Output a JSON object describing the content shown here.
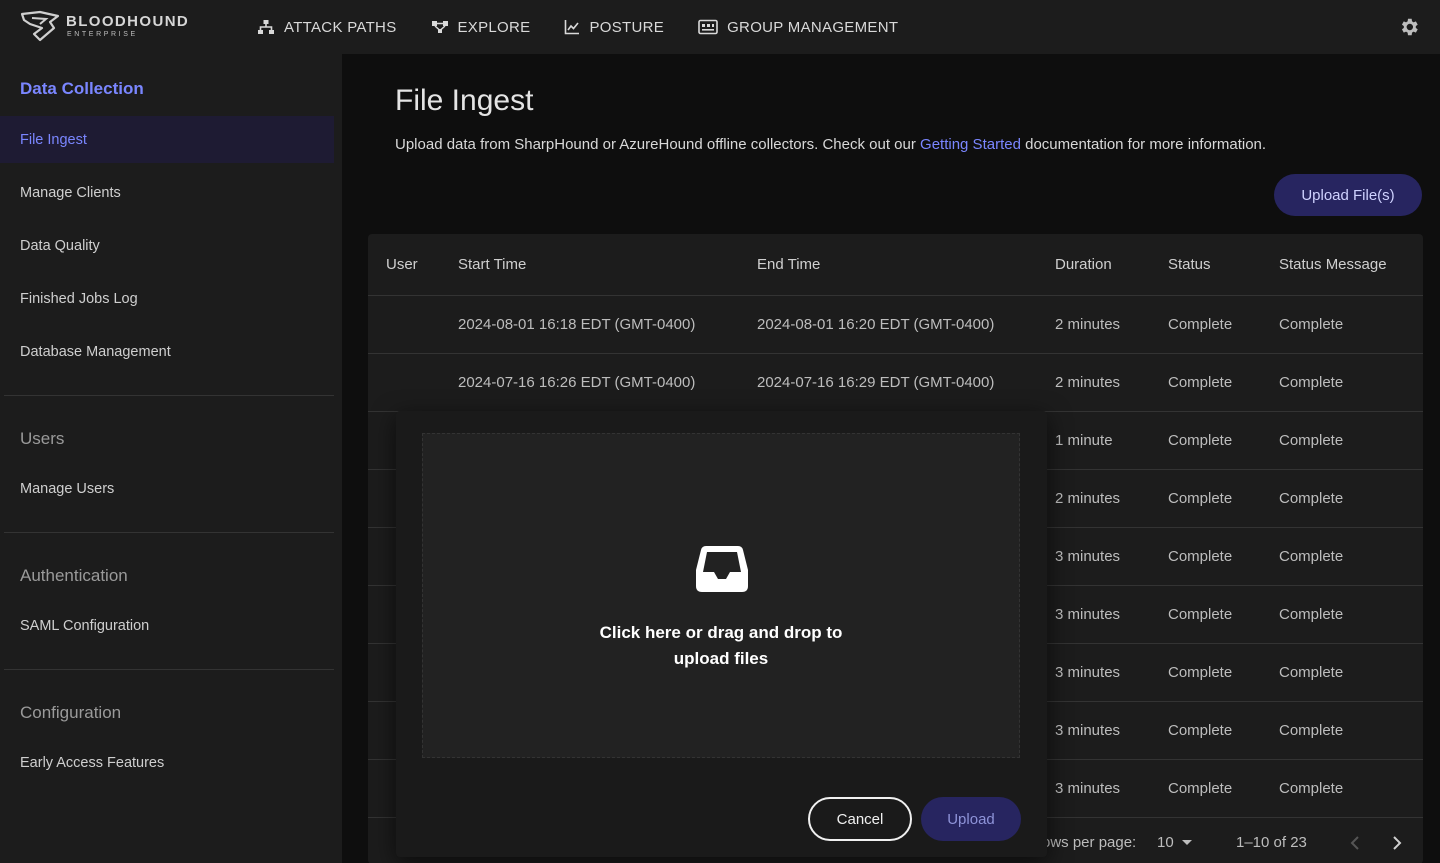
{
  "app": {
    "logo_main": "BLOODHOUND",
    "logo_sub": "ENTERPRISE"
  },
  "nav": {
    "items": [
      {
        "label": "ATTACK PATHS",
        "icon": "sitemap-icon"
      },
      {
        "label": "EXPLORE",
        "icon": "graph-nodes-icon"
      },
      {
        "label": "POSTURE",
        "icon": "line-chart-icon"
      },
      {
        "label": "GROUP MANAGEMENT",
        "icon": "id-card-icon"
      }
    ],
    "settings_icon": "gear-icon"
  },
  "sidebar": {
    "sections": [
      {
        "title": "Data Collection",
        "items": [
          "File Ingest",
          "Manage Clients",
          "Data Quality",
          "Finished Jobs Log",
          "Database Management"
        ]
      },
      {
        "title": "Users",
        "items": [
          "Manage Users"
        ]
      },
      {
        "title": "Authentication",
        "items": [
          "SAML Configuration"
        ]
      },
      {
        "title": "Configuration",
        "items": [
          "Early Access Features"
        ]
      }
    ],
    "selected": "File Ingest"
  },
  "main": {
    "title": "File Ingest",
    "desc_before": "Upload data from SharpHound or AzureHound offline collectors. Check out our ",
    "desc_link": "Getting Started",
    "desc_after": " documentation for more information.",
    "upload_button": "Upload File(s)"
  },
  "table": {
    "columns": [
      "User",
      "Start Time",
      "End Time",
      "Duration",
      "Status",
      "Status Message"
    ],
    "rows": [
      {
        "user": "",
        "start": "2024-08-01 16:18 EDT (GMT-0400)",
        "end": "2024-08-01 16:20 EDT (GMT-0400)",
        "duration": "2 minutes",
        "status": "Complete",
        "message": "Complete"
      },
      {
        "user": "",
        "start": "2024-07-16 16:26 EDT (GMT-0400)",
        "end": "2024-07-16 16:29 EDT (GMT-0400)",
        "duration": "2 minutes",
        "status": "Complete",
        "message": "Complete"
      },
      {
        "user": "",
        "start": "",
        "end": "",
        "duration": "1 minute",
        "status": "Complete",
        "message": "Complete"
      },
      {
        "user": "",
        "start": "",
        "end": "",
        "duration": "2 minutes",
        "status": "Complete",
        "message": "Complete"
      },
      {
        "user": "",
        "start": "",
        "end": "",
        "duration": "3 minutes",
        "status": "Complete",
        "message": "Complete"
      },
      {
        "user": "",
        "start": "",
        "end": "",
        "duration": "3 minutes",
        "status": "Complete",
        "message": "Complete"
      },
      {
        "user": "",
        "start": "",
        "end": "",
        "duration": "3 minutes",
        "status": "Complete",
        "message": "Complete"
      },
      {
        "user": "",
        "start": "",
        "end": "",
        "duration": "3 minutes",
        "status": "Complete",
        "message": "Complete"
      },
      {
        "user": "",
        "start": "",
        "end": "",
        "duration": "3 minutes",
        "status": "Complete",
        "message": "Complete"
      }
    ],
    "pagination": {
      "rows_per_page_label": "ows per page:",
      "rows_per_page": "10",
      "range": "1–10 of 23"
    }
  },
  "modal": {
    "dropzone_line1": "Click here or drag and drop to",
    "dropzone_line2": "upload files",
    "dropzone_icon": "inbox-tray-icon",
    "cancel": "Cancel",
    "upload": "Upload"
  },
  "colors": {
    "accent": "#7a86ff",
    "button_bg": "#272560",
    "panel": "#1c1c1c",
    "background": "#0e0e0e"
  }
}
